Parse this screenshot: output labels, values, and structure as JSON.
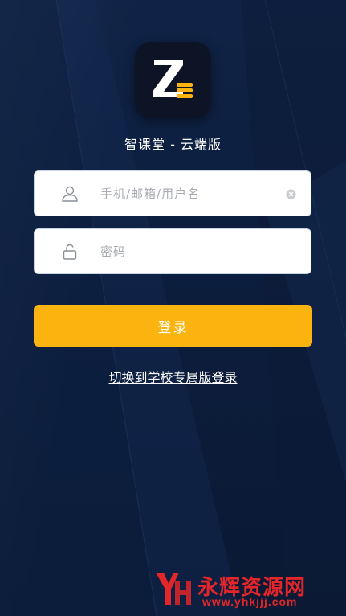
{
  "app": {
    "title": "智课堂 - 云端版"
  },
  "login_form": {
    "username_placeholder": "手机/邮箱/用户名",
    "username_value": "",
    "password_placeholder": "密码",
    "password_value": "",
    "submit_label": "登录"
  },
  "switch_link_label": "切换到学校专属版登录",
  "watermark": {
    "name": "永辉资源网",
    "url": "www.yhkjjj.com"
  },
  "colors": {
    "background": "#0d1e3e",
    "accent": "#fbb40f",
    "input_background": "#ffffff",
    "watermark": "#e2262a"
  },
  "icons": {
    "logo": "z-logo-icon",
    "username": "user-icon",
    "password": "unlock-icon",
    "clear": "clear-icon",
    "watermark": "yh-logo-icon"
  }
}
